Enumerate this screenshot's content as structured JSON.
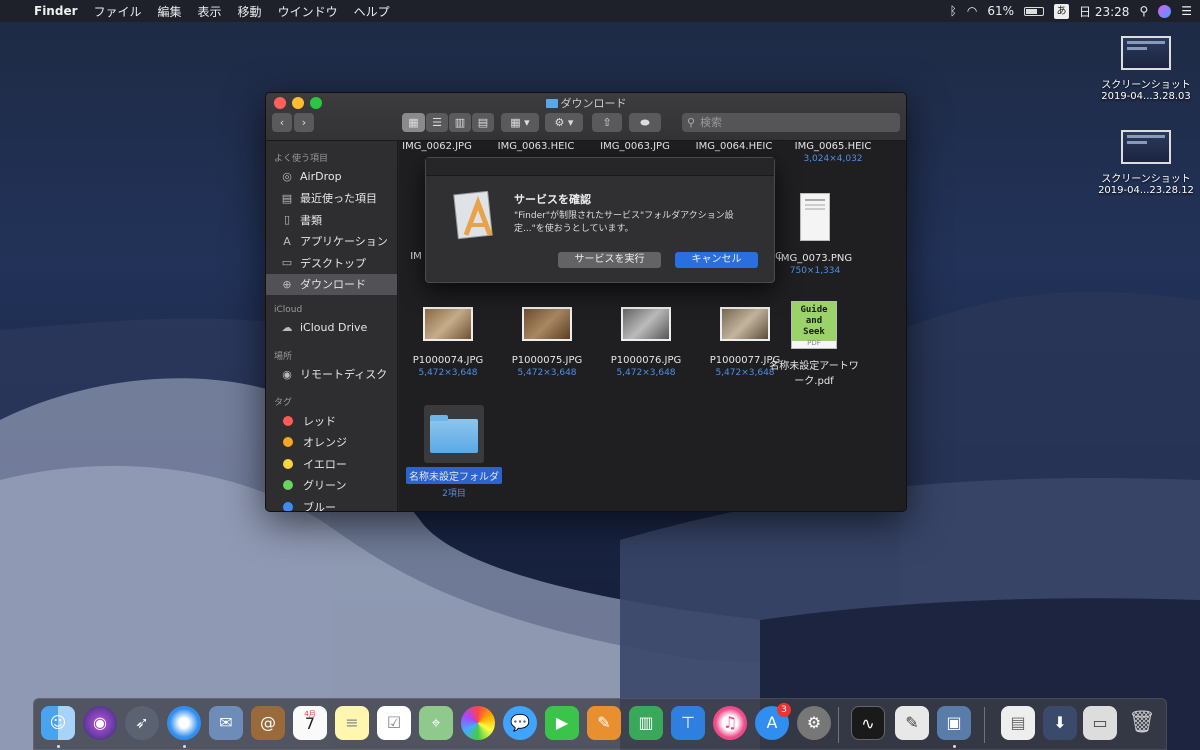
{
  "menubar": {
    "app_name": "Finder",
    "menus": [
      "ファイル",
      "編集",
      "表示",
      "移動",
      "ウインドウ",
      "ヘルプ"
    ],
    "battery_percent": "61%",
    "ime": "あ",
    "clock": "日 23:28",
    "battery_level": 0.61
  },
  "desktop": {
    "icons": [
      {
        "line1": "スクリーンショット",
        "line2": "2019-04...3.28.03"
      },
      {
        "line1": "スクリーンショット",
        "line2": "2019-04...23.28.12"
      }
    ]
  },
  "window": {
    "title": "ダウンロード",
    "search_placeholder": "検索"
  },
  "sidebar": {
    "favorites_header": "よく使う項目",
    "favorites": [
      "AirDrop",
      "最近使った項目",
      "書類",
      "アプリケーション",
      "デスクトップ",
      "ダウンロード"
    ],
    "icloud_header": "iCloud",
    "icloud": [
      "iCloud Drive"
    ],
    "locations_header": "場所",
    "locations": [
      "リモートディスク"
    ],
    "tags_header": "タグ",
    "tags": [
      {
        "label": "レッド",
        "color": "#ff5b56"
      },
      {
        "label": "オレンジ",
        "color": "#f5a623"
      },
      {
        "label": "イエロー",
        "color": "#f8d53c"
      },
      {
        "label": "グリーン",
        "color": "#6bd45f"
      },
      {
        "label": "ブルー",
        "color": "#3f8cf0"
      }
    ]
  },
  "files": {
    "row1": [
      {
        "name": "IMG_0062.JPG"
      },
      {
        "name": "IMG_0063.HEIC"
      },
      {
        "name": "IMG_0063.JPG"
      },
      {
        "name": "IMG_0064.HEIC"
      },
      {
        "name": "IMG_0065.HEIC",
        "meta": "3,024×4,032"
      }
    ],
    "row2_partial_left": "IM",
    "row2_partial_right": "EIC",
    "row2_png": {
      "name": "IMG_0073.PNG",
      "meta": "750×1,334"
    },
    "row3": [
      {
        "name": "P1000074.JPG",
        "meta": "5,472×3,648"
      },
      {
        "name": "P1000075.JPG",
        "meta": "5,472×3,648"
      },
      {
        "name": "P1000076.JPG",
        "meta": "5,472×3,648"
      },
      {
        "name": "P1000077.JPG",
        "meta": "5,472×3,648"
      }
    ],
    "pdf": {
      "line1": "名称未設定アートワ",
      "line2": "ーク.pdf",
      "thumb_text": "Guide and Seek",
      "badge": "PDF"
    },
    "folder": {
      "name": "名称未設定フォルダ",
      "meta": "2項目"
    }
  },
  "dialog": {
    "title": "サービスを確認",
    "message": "\"Finder\"が制限されたサービス\"フォルダアクション設定...\"を使おうとしています。",
    "run_button": "サービスを実行",
    "cancel_button": "キャンセル"
  },
  "dock": {
    "calendar_month": "4月",
    "calendar_day": "7",
    "appstore_badge": "3"
  }
}
